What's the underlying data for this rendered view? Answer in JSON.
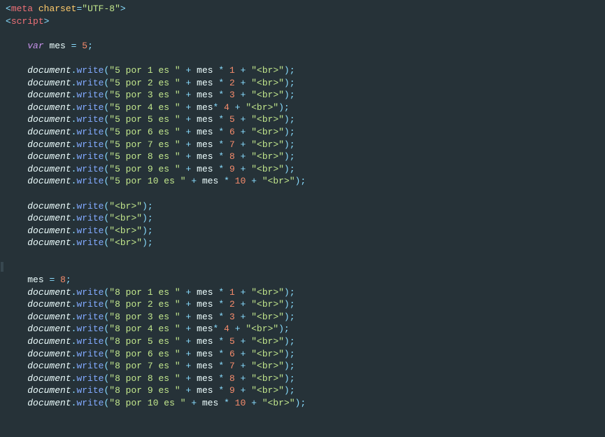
{
  "meta": {
    "charset_attr": "charset",
    "charset_val": "UTF-8",
    "meta_tag": "meta",
    "script_tag": "script"
  },
  "kw_var": "var",
  "var_mes": "mes",
  "obj_document": "document",
  "method_write": "write",
  "init5": "5",
  "init8": "8",
  "br_only": "\"<br>\"",
  "block5": [
    {
      "s": "\"5 por 1 es \"",
      "n": "1",
      "space": true
    },
    {
      "s": "\"5 por 2 es \"",
      "n": "2",
      "space": true
    },
    {
      "s": "\"5 por 3 es \"",
      "n": "3",
      "space": true
    },
    {
      "s": "\"5 por 4 es \"",
      "n": "4",
      "space": false
    },
    {
      "s": "\"5 por 5 es \"",
      "n": "5",
      "space": true
    },
    {
      "s": "\"5 por 6 es \"",
      "n": "6",
      "space": true
    },
    {
      "s": "\"5 por 7 es \"",
      "n": "7",
      "space": true
    },
    {
      "s": "\"5 por 8 es \"",
      "n": "8",
      "space": true
    },
    {
      "s": "\"5 por 9 es \"",
      "n": "9",
      "space": true
    },
    {
      "s": "\"5 por 10 es \"",
      "n": "10",
      "space": true
    }
  ],
  "block8": [
    {
      "s": "\"8 por 1 es \"",
      "n": "1",
      "space": true
    },
    {
      "s": "\"8 por 2 es \"",
      "n": "2",
      "space": true
    },
    {
      "s": "\"8 por 3 es \"",
      "n": "3",
      "space": true
    },
    {
      "s": "\"8 por 4 es \"",
      "n": "4",
      "space": false
    },
    {
      "s": "\"8 por 5 es \"",
      "n": "5",
      "space": true
    },
    {
      "s": "\"8 por 6 es \"",
      "n": "6",
      "space": true
    },
    {
      "s": "\"8 por 7 es \"",
      "n": "7",
      "space": true
    },
    {
      "s": "\"8 por 8 es \"",
      "n": "8",
      "space": true
    },
    {
      "s": "\"8 por 9 es \"",
      "n": "9",
      "space": true
    },
    {
      "s": "\"8 por 10 es \"",
      "n": "10",
      "space": true
    }
  ],
  "br_tag_string": "\"<br>\""
}
